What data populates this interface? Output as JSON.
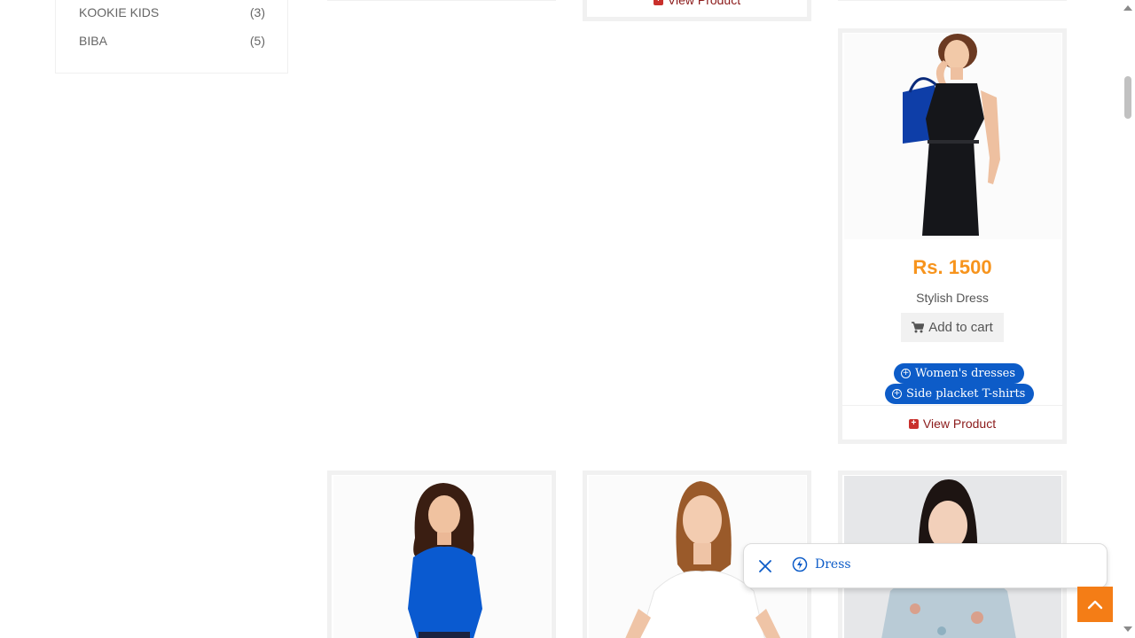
{
  "sidebar": {
    "brands": [
      {
        "name": "KOOKIE KIDS",
        "count": "(3)"
      },
      {
        "name": "BIBA",
        "count": "(5)"
      }
    ]
  },
  "card_top_middle": {
    "view_label": "View Product"
  },
  "featured_card": {
    "price": "Rs. 1500",
    "name": "Stylish Dress",
    "add_to_cart_label": "Add to cart",
    "tags": [
      "Women's dresses",
      "Side placket T-shirts"
    ],
    "view_label": "View Product"
  },
  "search_chip": {
    "query": "Dress"
  },
  "colors": {
    "price": "#f7941d",
    "tag": "#0d5cc8",
    "view_link": "#8b1a1a",
    "scroll_top": "#f47d16"
  },
  "icons": {
    "cart": "shopping-cart-icon",
    "tag_plus": "plus-circle-icon",
    "view": "plus-square-icon",
    "close": "close-icon",
    "query": "lightning-icon",
    "to_top": "chevron-up-icon"
  }
}
